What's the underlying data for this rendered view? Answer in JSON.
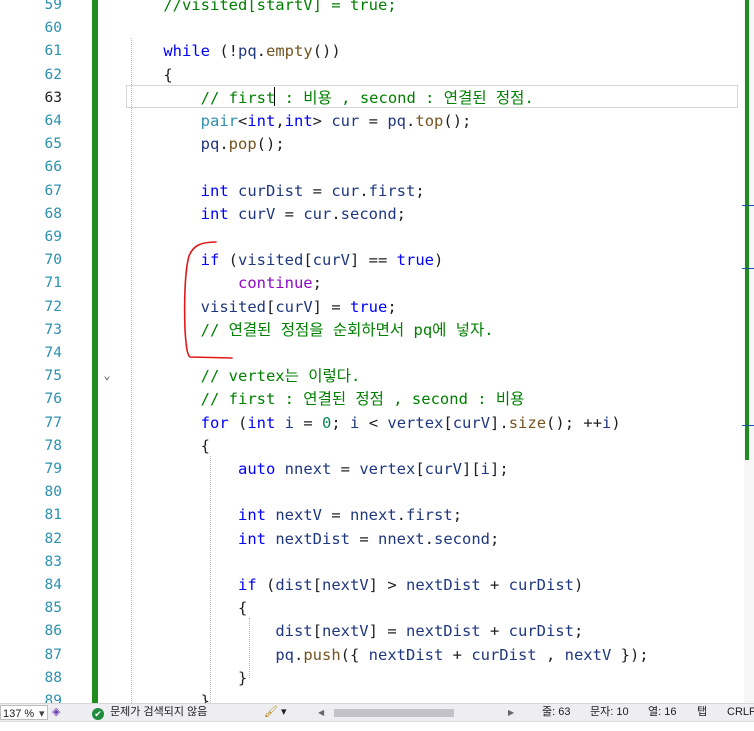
{
  "editor": {
    "line_numbers": [
      "59",
      "60",
      "61",
      "62",
      "63",
      "64",
      "65",
      "66",
      "67",
      "68",
      "69",
      "70",
      "71",
      "72",
      "73",
      "74",
      "75",
      "76",
      "77",
      "78",
      "79",
      "80",
      "81",
      "82",
      "83",
      "84",
      "85",
      "86",
      "87",
      "88",
      "89"
    ],
    "current_line": "63",
    "fold_glyph": "⌄",
    "code_lines": [
      [
        {
          "t": "    "
        },
        {
          "c": "cm",
          "t": "//visited[startV] = true;"
        }
      ],
      [],
      [
        {
          "t": "    "
        },
        {
          "c": "kw",
          "t": "while"
        },
        {
          "t": " (!"
        },
        {
          "c": "var",
          "t": "pq"
        },
        {
          "t": "."
        },
        {
          "c": "fn",
          "t": "empty"
        },
        {
          "t": "())"
        }
      ],
      [
        {
          "t": "    {"
        }
      ],
      [
        {
          "t": "        "
        },
        {
          "c": "cm",
          "t": "// first : 비용 , second : 연결된 정점."
        }
      ],
      [
        {
          "t": "        "
        },
        {
          "c": "tp",
          "t": "pair"
        },
        {
          "t": "<"
        },
        {
          "c": "ty",
          "t": "int"
        },
        {
          "t": ","
        },
        {
          "c": "ty",
          "t": "int"
        },
        {
          "t": "> "
        },
        {
          "c": "var",
          "t": "cur"
        },
        {
          "t": " = "
        },
        {
          "c": "var",
          "t": "pq"
        },
        {
          "t": "."
        },
        {
          "c": "fn",
          "t": "top"
        },
        {
          "t": "();"
        }
      ],
      [
        {
          "t": "        "
        },
        {
          "c": "var",
          "t": "pq"
        },
        {
          "t": "."
        },
        {
          "c": "fn",
          "t": "pop"
        },
        {
          "t": "();"
        }
      ],
      [],
      [
        {
          "t": "        "
        },
        {
          "c": "ty",
          "t": "int"
        },
        {
          "t": " "
        },
        {
          "c": "var",
          "t": "curDist"
        },
        {
          "t": " = "
        },
        {
          "c": "var",
          "t": "cur"
        },
        {
          "t": "."
        },
        {
          "c": "fld",
          "t": "first"
        },
        {
          "t": ";"
        }
      ],
      [
        {
          "t": "        "
        },
        {
          "c": "ty",
          "t": "int"
        },
        {
          "t": " "
        },
        {
          "c": "var",
          "t": "curV"
        },
        {
          "t": " = "
        },
        {
          "c": "var",
          "t": "cur"
        },
        {
          "t": "."
        },
        {
          "c": "fld",
          "t": "second"
        },
        {
          "t": ";"
        }
      ],
      [],
      [
        {
          "t": "        "
        },
        {
          "c": "kw",
          "t": "if"
        },
        {
          "t": " ("
        },
        {
          "c": "var",
          "t": "visited"
        },
        {
          "t": "["
        },
        {
          "c": "var",
          "t": "curV"
        },
        {
          "t": "] == "
        },
        {
          "c": "kw",
          "t": "true"
        },
        {
          "t": ")"
        }
      ],
      [
        {
          "t": "            "
        },
        {
          "c": "ctl",
          "t": "continue"
        },
        {
          "t": ";"
        }
      ],
      [
        {
          "t": "        "
        },
        {
          "c": "var",
          "t": "visited"
        },
        {
          "t": "["
        },
        {
          "c": "var",
          "t": "curV"
        },
        {
          "t": "] = "
        },
        {
          "c": "kw",
          "t": "true"
        },
        {
          "t": ";"
        }
      ],
      [
        {
          "t": "        "
        },
        {
          "c": "cm",
          "t": "// 연결된 정점을 순회하면서 pq에 넣자."
        }
      ],
      [],
      [
        {
          "t": "        "
        },
        {
          "c": "cm",
          "t": "// vertex는 이렇다."
        }
      ],
      [
        {
          "t": "        "
        },
        {
          "c": "cm",
          "t": "// first : 연결된 정점 , second : 비용"
        }
      ],
      [
        {
          "t": "        "
        },
        {
          "c": "kw",
          "t": "for"
        },
        {
          "t": " ("
        },
        {
          "c": "ty",
          "t": "int"
        },
        {
          "t": " "
        },
        {
          "c": "var",
          "t": "i"
        },
        {
          "t": " = "
        },
        {
          "c": "num",
          "t": "0"
        },
        {
          "t": "; "
        },
        {
          "c": "var",
          "t": "i"
        },
        {
          "t": " < "
        },
        {
          "c": "var",
          "t": "vertex"
        },
        {
          "t": "["
        },
        {
          "c": "var",
          "t": "curV"
        },
        {
          "t": "]."
        },
        {
          "c": "fn",
          "t": "size"
        },
        {
          "t": "(); ++"
        },
        {
          "c": "var",
          "t": "i"
        },
        {
          "t": ")"
        }
      ],
      [
        {
          "t": "        {"
        }
      ],
      [
        {
          "t": "            "
        },
        {
          "c": "kw",
          "t": "auto"
        },
        {
          "t": " "
        },
        {
          "c": "var",
          "t": "nnext"
        },
        {
          "t": " = "
        },
        {
          "c": "var",
          "t": "vertex"
        },
        {
          "t": "["
        },
        {
          "c": "var",
          "t": "curV"
        },
        {
          "t": "]["
        },
        {
          "c": "var",
          "t": "i"
        },
        {
          "t": "];"
        }
      ],
      [],
      [
        {
          "t": "            "
        },
        {
          "c": "ty",
          "t": "int"
        },
        {
          "t": " "
        },
        {
          "c": "var",
          "t": "nextV"
        },
        {
          "t": " = "
        },
        {
          "c": "var",
          "t": "nnext"
        },
        {
          "t": "."
        },
        {
          "c": "fld",
          "t": "first"
        },
        {
          "t": ";"
        }
      ],
      [
        {
          "t": "            "
        },
        {
          "c": "ty",
          "t": "int"
        },
        {
          "t": " "
        },
        {
          "c": "var",
          "t": "nextDist"
        },
        {
          "t": " = "
        },
        {
          "c": "var",
          "t": "nnext"
        },
        {
          "t": "."
        },
        {
          "c": "fld",
          "t": "second"
        },
        {
          "t": ";"
        }
      ],
      [],
      [
        {
          "t": "            "
        },
        {
          "c": "kw",
          "t": "if"
        },
        {
          "t": " ("
        },
        {
          "c": "var",
          "t": "dist"
        },
        {
          "t": "["
        },
        {
          "c": "var",
          "t": "nextV"
        },
        {
          "t": "] > "
        },
        {
          "c": "var",
          "t": "nextDist"
        },
        {
          "t": " + "
        },
        {
          "c": "var",
          "t": "curDist"
        },
        {
          "t": ")"
        }
      ],
      [
        {
          "t": "            {"
        }
      ],
      [
        {
          "t": "                "
        },
        {
          "c": "var",
          "t": "dist"
        },
        {
          "t": "["
        },
        {
          "c": "var",
          "t": "nextV"
        },
        {
          "t": "] = "
        },
        {
          "c": "var",
          "t": "nextDist"
        },
        {
          "t": " + "
        },
        {
          "c": "var",
          "t": "curDist"
        },
        {
          "t": ";"
        }
      ],
      [
        {
          "t": "                "
        },
        {
          "c": "var",
          "t": "pq"
        },
        {
          "t": "."
        },
        {
          "c": "fn",
          "t": "push"
        },
        {
          "t": "({ "
        },
        {
          "c": "var",
          "t": "nextDist"
        },
        {
          "t": " + "
        },
        {
          "c": "var",
          "t": "curDist"
        },
        {
          "t": " , "
        },
        {
          "c": "var",
          "t": "nextV"
        },
        {
          "t": " });"
        }
      ],
      [
        {
          "t": "            }"
        }
      ],
      [
        {
          "t": "        }"
        }
      ]
    ]
  },
  "status_bar": {
    "zoom": "137 %",
    "zoom_dropdown_glyph": "▾",
    "issues_text": "문제가 검색되지 않음",
    "issues_check_glyph": "✔",
    "brush_glyph": "🖌",
    "brush_dropdown_glyph": "▾",
    "scroll_left_glyph": "◀",
    "scroll_right_glyph": "▶",
    "line_label": "줄: 63",
    "char_label": "문자: 10",
    "col_label": "열: 16",
    "tab_label": "탭",
    "eol_label": "CRLF"
  }
}
